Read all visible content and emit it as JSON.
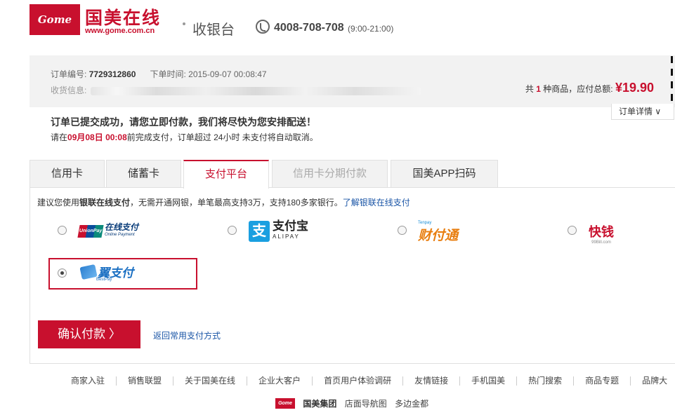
{
  "header": {
    "logo_text": "Gome",
    "brand_name": "国美在线",
    "brand_url": "www.gome.com.cn",
    "page_title": "收银台",
    "phone": "4008-708-708",
    "phone_hours": "(9:00-21:00)"
  },
  "order": {
    "number_label": "订单编号:",
    "number": "7729312860",
    "time_label": "下单时间:",
    "time": "2015-09-07 00:08:47",
    "address_label": "收货信息:",
    "total_prefix": "共",
    "item_count": "1",
    "total_suffix": "种商品，应付总额:",
    "amount": "¥19.90",
    "detail_button": "订单详情"
  },
  "message": {
    "title": "订单已提交成功，请您立即付款，我们将尽快为您安排配送！",
    "deadline_prefix": "请在",
    "deadline_date": "09月08日",
    "deadline_time": "00:08",
    "deadline_suffix": "前完成支付，订单超过 24小时 未支付将自动取消。"
  },
  "tabs": [
    {
      "label": "信用卡"
    },
    {
      "label": "储蓄卡"
    },
    {
      "label": "支付平台"
    },
    {
      "label": "信用卡分期付款"
    },
    {
      "label": "国美APP扫码"
    }
  ],
  "platform": {
    "tip_prefix": "建议您使用",
    "tip_bold": "银联在线支付",
    "tip_suffix": "，无需开通网银，单笔最高支持3万，支持180多家银行。",
    "tip_link": "了解银联在线支付",
    "options": [
      {
        "name": "UnionPay 银联",
        "title": "在线支付",
        "subtitle": "Online Payment",
        "checked": false
      },
      {
        "name": "支",
        "title": "支付宝",
        "subtitle": "ALIPAY",
        "checked": false
      },
      {
        "name": "Tenpay",
        "title": "财付通",
        "checked": false
      },
      {
        "name": "快钱",
        "subtitle": "99Bill.com",
        "checked": false
      },
      {
        "name": "翼支付",
        "subtitle": "BestPay",
        "checked": true
      }
    ]
  },
  "actions": {
    "confirm_button": "确认付款 〉",
    "back_link": "返回常用支付方式"
  },
  "footer": {
    "links": [
      "商家入驻",
      "销售联盟",
      "关于国美在线",
      "企业大客户",
      "首页用户体验调研",
      "友情链接",
      "手机国美",
      "热门搜索",
      "商品专题",
      "品牌大"
    ],
    "logo_text": "Gome",
    "bottom": [
      "国美集团",
      "店面导航图",
      "多边金都"
    ]
  },
  "colors": {
    "brand_red": "#c8102e",
    "link_blue": "#1a55a6"
  }
}
